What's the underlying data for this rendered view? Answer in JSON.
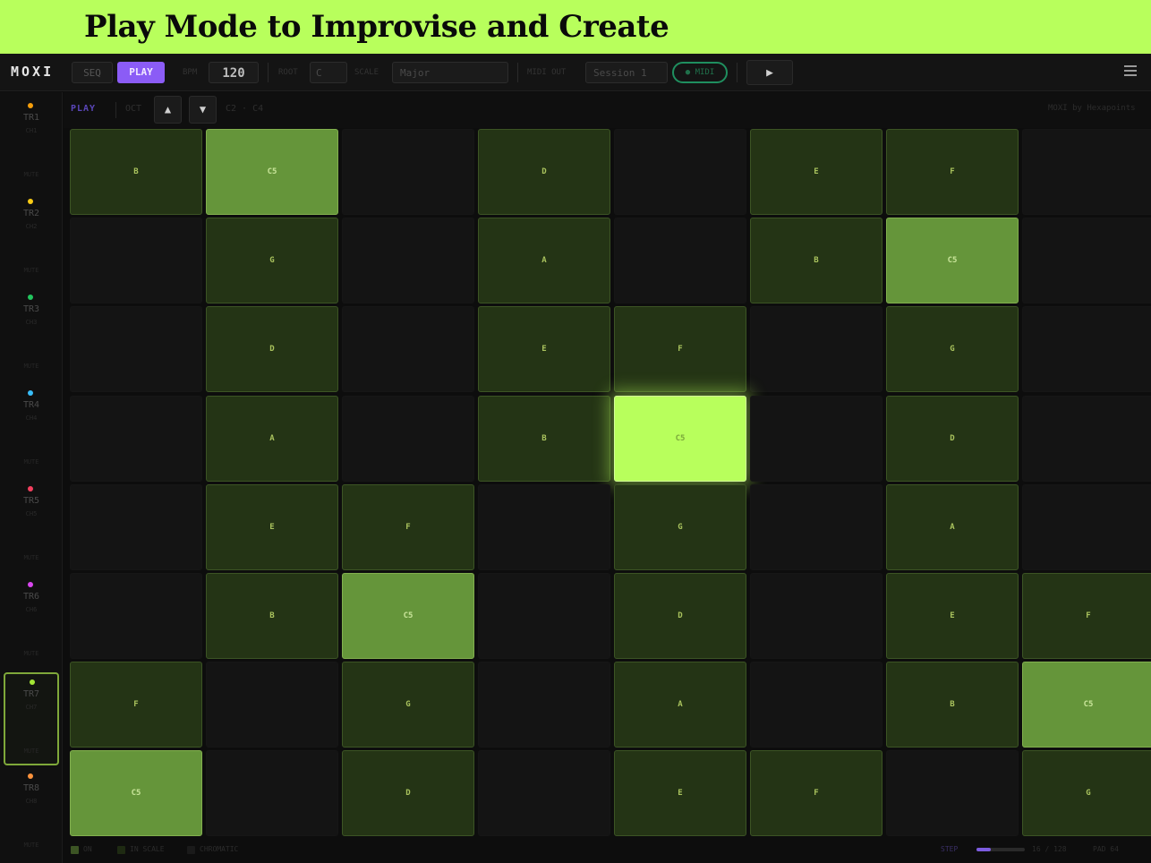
{
  "banner": {
    "title": "Play Mode to Improvise and Create"
  },
  "topbar": {
    "logo": "MOXI",
    "seq_label": "SEQ",
    "play_label": "PLAY",
    "bpm_label": "BPM",
    "bpm_value": "120",
    "root_label": "ROOT",
    "root_value": "C",
    "scale_label": "SCALE",
    "scale_value": "Major",
    "midi_label": "MIDI OUT",
    "midi_value": "Session 1",
    "midi_pill": "● MIDI",
    "transport_glyph": "▶"
  },
  "subbar": {
    "mode": "PLAY",
    "oct_label": "OCT",
    "up_glyph": "▲",
    "down_glyph": "▼",
    "range": "C2 · C4",
    "right_text": "MOXI by Hexapoints"
  },
  "colors": {
    "accent": "#b8ff5c",
    "play_button": "#8b5cf6",
    "pad_on": "#243415",
    "pad_highlight": "#65953a",
    "pad_hot": "#b8ff5c"
  },
  "tracks": [
    {
      "name": "TR1",
      "sub": "CH1",
      "foot": "MUTE",
      "color": "#f59e0b",
      "active": false
    },
    {
      "name": "TR2",
      "sub": "CH2",
      "foot": "MUTE",
      "color": "#facc15",
      "active": false
    },
    {
      "name": "TR3",
      "sub": "CH3",
      "foot": "MUTE",
      "color": "#22c55e",
      "active": false
    },
    {
      "name": "TR4",
      "sub": "CH4",
      "foot": "MUTE",
      "color": "#38bdf8",
      "active": false
    },
    {
      "name": "TR5",
      "sub": "CH5",
      "foot": "MUTE",
      "color": "#f43f5e",
      "active": false
    },
    {
      "name": "TR6",
      "sub": "CH6",
      "foot": "MUTE",
      "color": "#d946ef",
      "active": false
    },
    {
      "name": "TR7",
      "sub": "CH7",
      "foot": "MUTE",
      "color": "#a3e635",
      "active": true
    },
    {
      "name": "TR8",
      "sub": "CH8",
      "foot": "MUTE",
      "color": "#fb923c",
      "active": false
    }
  ],
  "pads": [
    [
      {
        "note": "B",
        "state": "on"
      },
      {
        "note": "C5",
        "state": "hi"
      },
      {
        "note": "",
        "state": "off"
      },
      {
        "note": "D",
        "state": "on"
      },
      {
        "note": "",
        "state": "off"
      },
      {
        "note": "E",
        "state": "on"
      },
      {
        "note": "F",
        "state": "on"
      },
      {
        "note": "",
        "state": "off"
      }
    ],
    [
      {
        "note": "",
        "state": "off"
      },
      {
        "note": "G",
        "state": "on"
      },
      {
        "note": "",
        "state": "off"
      },
      {
        "note": "A",
        "state": "on"
      },
      {
        "note": "",
        "state": "off"
      },
      {
        "note": "B",
        "state": "on"
      },
      {
        "note": "C5",
        "state": "hi"
      },
      {
        "note": "",
        "state": "off"
      }
    ],
    [
      {
        "note": "",
        "state": "off"
      },
      {
        "note": "D",
        "state": "on"
      },
      {
        "note": "",
        "state": "off"
      },
      {
        "note": "E",
        "state": "on"
      },
      {
        "note": "F",
        "state": "on"
      },
      {
        "note": "",
        "state": "off"
      },
      {
        "note": "G",
        "state": "on"
      },
      {
        "note": "",
        "state": "off"
      }
    ],
    [
      {
        "note": "",
        "state": "off"
      },
      {
        "note": "A",
        "state": "on"
      },
      {
        "note": "",
        "state": "off"
      },
      {
        "note": "B",
        "state": "on"
      },
      {
        "note": "C5",
        "state": "hot"
      },
      {
        "note": "",
        "state": "off"
      },
      {
        "note": "D",
        "state": "on"
      },
      {
        "note": "",
        "state": "off"
      }
    ],
    [
      {
        "note": "",
        "state": "off"
      },
      {
        "note": "E",
        "state": "on"
      },
      {
        "note": "F",
        "state": "on"
      },
      {
        "note": "",
        "state": "off"
      },
      {
        "note": "G",
        "state": "on"
      },
      {
        "note": "",
        "state": "off"
      },
      {
        "note": "A",
        "state": "on"
      },
      {
        "note": "",
        "state": "off"
      }
    ],
    [
      {
        "note": "",
        "state": "off"
      },
      {
        "note": "B",
        "state": "on"
      },
      {
        "note": "C5",
        "state": "hi"
      },
      {
        "note": "",
        "state": "off"
      },
      {
        "note": "D",
        "state": "on"
      },
      {
        "note": "",
        "state": "off"
      },
      {
        "note": "E",
        "state": "on"
      },
      {
        "note": "F",
        "state": "on"
      }
    ],
    [
      {
        "note": "F",
        "state": "on"
      },
      {
        "note": "",
        "state": "off"
      },
      {
        "note": "G",
        "state": "on"
      },
      {
        "note": "",
        "state": "off"
      },
      {
        "note": "A",
        "state": "on"
      },
      {
        "note": "",
        "state": "off"
      },
      {
        "note": "B",
        "state": "on"
      },
      {
        "note": "C5",
        "state": "hi"
      }
    ],
    [
      {
        "note": "C5",
        "state": "hi"
      },
      {
        "note": "",
        "state": "off"
      },
      {
        "note": "D",
        "state": "on"
      },
      {
        "note": "",
        "state": "off"
      },
      {
        "note": "E",
        "state": "on"
      },
      {
        "note": "F",
        "state": "on"
      },
      {
        "note": "",
        "state": "off"
      },
      {
        "note": "G",
        "state": "on"
      }
    ]
  ],
  "bottombar": {
    "legend_on": "ON",
    "legend_in_scale": "IN SCALE",
    "legend_other": "CHROMATIC",
    "step_label": "STEP",
    "step_progress": 0.3,
    "position": "16 / 128",
    "pad_count": "PAD 64"
  }
}
